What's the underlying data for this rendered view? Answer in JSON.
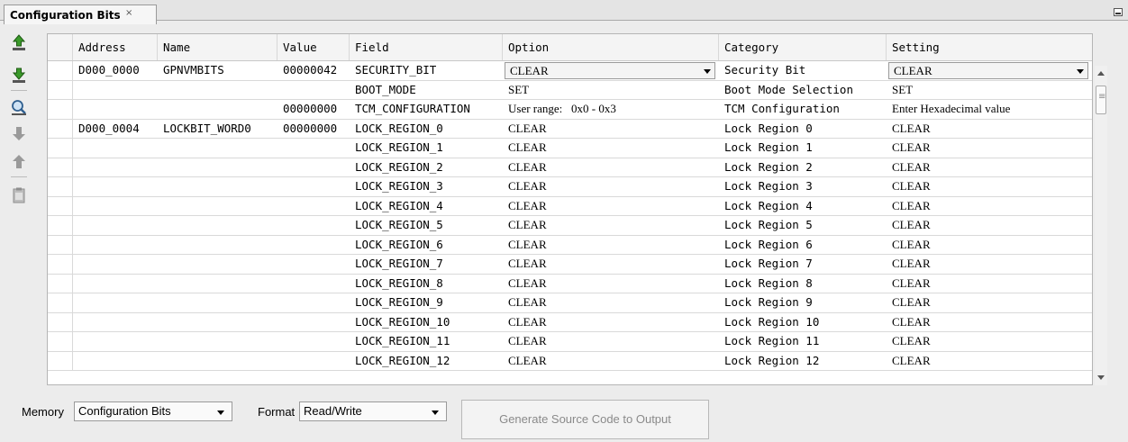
{
  "window": {
    "tab_title": "Configuration Bits",
    "tab_close_glyph": "×"
  },
  "toolbar": {
    "icons": [
      "read-config-icon",
      "program-config-icon",
      "search-icon",
      "move-down-icon",
      "move-up-icon",
      "clipboard-icon"
    ]
  },
  "table": {
    "columns": [
      "Address",
      "Name",
      "Value",
      "Field",
      "Option",
      "Category",
      "Setting"
    ],
    "rows": [
      {
        "address": "D000_0000",
        "name": "GPNVMBITS",
        "value": "00000042",
        "field": "SECURITY_BIT",
        "option": "CLEAR",
        "option_dropdown": true,
        "category": "Security Bit",
        "setting": "CLEAR",
        "setting_dropdown": true
      },
      {
        "address": "",
        "name": "",
        "value": "",
        "field": "BOOT_MODE",
        "option": "SET",
        "category": "Boot Mode Selection",
        "setting": "SET"
      },
      {
        "address": "",
        "name": "",
        "value": "00000000",
        "field": "TCM_CONFIGURATION",
        "option": "User range:   0x0 - 0x3",
        "category": "TCM Configuration",
        "setting": "Enter Hexadecimal value"
      },
      {
        "address": "D000_0004",
        "name": "LOCKBIT_WORD0",
        "value": "00000000",
        "field": "LOCK_REGION_0",
        "option": "CLEAR",
        "category": "Lock Region 0",
        "setting": "CLEAR"
      },
      {
        "address": "",
        "name": "",
        "value": "",
        "field": "LOCK_REGION_1",
        "option": "CLEAR",
        "category": "Lock Region 1",
        "setting": "CLEAR"
      },
      {
        "address": "",
        "name": "",
        "value": "",
        "field": "LOCK_REGION_2",
        "option": "CLEAR",
        "category": "Lock Region 2",
        "setting": "CLEAR"
      },
      {
        "address": "",
        "name": "",
        "value": "",
        "field": "LOCK_REGION_3",
        "option": "CLEAR",
        "category": "Lock Region 3",
        "setting": "CLEAR"
      },
      {
        "address": "",
        "name": "",
        "value": "",
        "field": "LOCK_REGION_4",
        "option": "CLEAR",
        "category": "Lock Region 4",
        "setting": "CLEAR"
      },
      {
        "address": "",
        "name": "",
        "value": "",
        "field": "LOCK_REGION_5",
        "option": "CLEAR",
        "category": "Lock Region 5",
        "setting": "CLEAR"
      },
      {
        "address": "",
        "name": "",
        "value": "",
        "field": "LOCK_REGION_6",
        "option": "CLEAR",
        "category": "Lock Region 6",
        "setting": "CLEAR"
      },
      {
        "address": "",
        "name": "",
        "value": "",
        "field": "LOCK_REGION_7",
        "option": "CLEAR",
        "category": "Lock Region 7",
        "setting": "CLEAR"
      },
      {
        "address": "",
        "name": "",
        "value": "",
        "field": "LOCK_REGION_8",
        "option": "CLEAR",
        "category": "Lock Region 8",
        "setting": "CLEAR"
      },
      {
        "address": "",
        "name": "",
        "value": "",
        "field": "LOCK_REGION_9",
        "option": "CLEAR",
        "category": "Lock Region 9",
        "setting": "CLEAR"
      },
      {
        "address": "",
        "name": "",
        "value": "",
        "field": "LOCK_REGION_10",
        "option": "CLEAR",
        "category": "Lock Region 10",
        "setting": "CLEAR"
      },
      {
        "address": "",
        "name": "",
        "value": "",
        "field": "LOCK_REGION_11",
        "option": "CLEAR",
        "category": "Lock Region 11",
        "setting": "CLEAR"
      },
      {
        "address": "",
        "name": "",
        "value": "",
        "field": "LOCK_REGION_12",
        "option": "CLEAR",
        "category": "Lock Region 12",
        "setting": "CLEAR"
      }
    ]
  },
  "bottom": {
    "memory_label": "Memory",
    "memory_value": "Configuration Bits",
    "format_label": "Format",
    "format_value": "Read/Write",
    "generate_button": "Generate Source Code to Output",
    "generate_enabled": false
  },
  "colors": {
    "background": "#ececec",
    "grid_background": "#ffffff",
    "disabled_text": "#8a8a8a",
    "icon_green": "#3a9a2a"
  }
}
